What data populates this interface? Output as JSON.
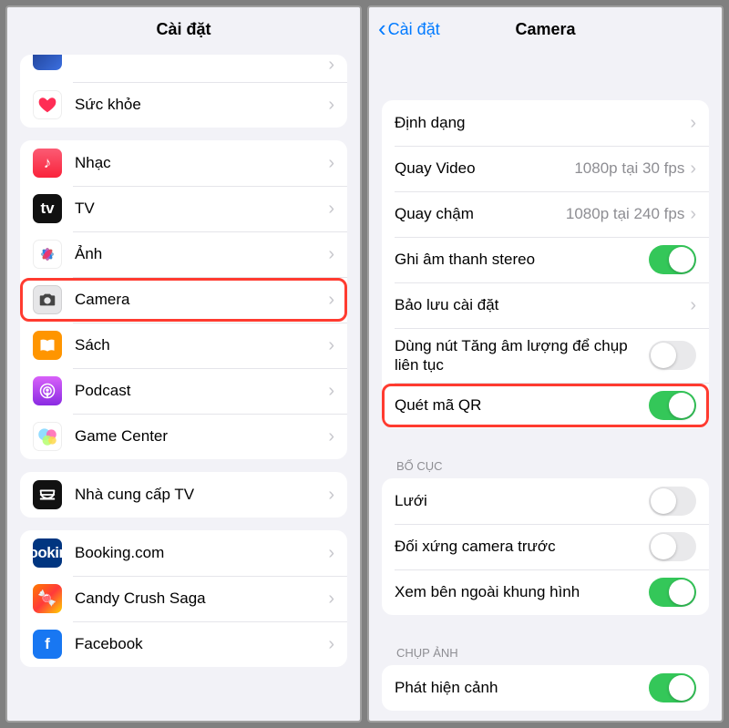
{
  "left": {
    "navTitle": "Cài đặt",
    "group0": {
      "health": "Sức khỏe"
    },
    "group1": {
      "music": "Nhạc",
      "tv": "TV",
      "photos": "Ảnh",
      "camera": "Camera",
      "books": "Sách",
      "podcast": "Podcast",
      "gamecenter": "Game Center"
    },
    "group2": {
      "tvprovider": "Nhà cung cấp TV"
    },
    "group3": {
      "booking": "Booking.com",
      "candy": "Candy Crush Saga",
      "facebook": "Facebook"
    }
  },
  "right": {
    "backLabel": "Cài đặt",
    "navTitle": "Camera",
    "group1": {
      "format": "Định dạng",
      "recordVideo": "Quay Video",
      "recordVideoDetail": "1080p tại 30 fps",
      "slowMo": "Quay chậm",
      "slowMoDetail": "1080p tại 240 fps",
      "stereo": "Ghi âm thanh stereo",
      "preserve": "Bảo lưu cài đặt",
      "burst": "Dùng nút Tăng âm lượng để chụp liên tục",
      "qr": "Quét mã QR"
    },
    "sectionLayout": "BỐ CỤC",
    "group2": {
      "grid": "Lưới",
      "mirror": "Đối xứng camera trước",
      "outside": "Xem bên ngoài khung hình"
    },
    "sectionCapture": "CHỤP ẢNH",
    "group3": {
      "scene": "Phát hiện cảnh"
    }
  }
}
